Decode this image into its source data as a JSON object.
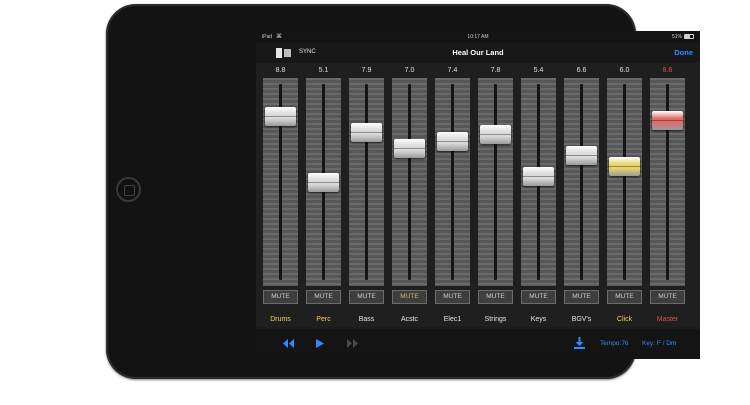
{
  "status_bar": {
    "carrier": "iPad",
    "time": "10:17 AM",
    "battery": "51%"
  },
  "nav": {
    "sync_label": "SYNC",
    "title": "Heal Our Land",
    "done_label": "Done"
  },
  "channels": [
    {
      "name": "Drums",
      "level": "8.8",
      "mute_label": "MUTE",
      "name_color": "#f2d35b",
      "knob_color": "#d9d9d9",
      "level_color": "#e0e0e0",
      "mute_color": "#cfcfcf",
      "fader": 0.88
    },
    {
      "name": "Perc",
      "level": "5.1",
      "mute_label": "MUTE",
      "name_color": "#f2d35b",
      "knob_color": "#d9d9d9",
      "level_color": "#e0e0e0",
      "mute_color": "#cfcfcf",
      "fader": 0.51
    },
    {
      "name": "Bass",
      "level": "7.9",
      "mute_label": "MUTE",
      "name_color": "#e6e6e6",
      "knob_color": "#d9d9d9",
      "level_color": "#e0e0e0",
      "mute_color": "#cfcfcf",
      "fader": 0.79
    },
    {
      "name": "Acstc",
      "level": "7.0",
      "mute_label": "MUTE",
      "name_color": "#e6e6e6",
      "knob_color": "#d9d9d9",
      "level_color": "#e0e0e0",
      "mute_color": "#c9bf5e",
      "fader": 0.7
    },
    {
      "name": "Elec1",
      "level": "7.4",
      "mute_label": "MUTE",
      "name_color": "#e6e6e6",
      "knob_color": "#d9d9d9",
      "level_color": "#e0e0e0",
      "mute_color": "#cfcfcf",
      "fader": 0.74
    },
    {
      "name": "Strings",
      "level": "7.8",
      "mute_label": "MUTE",
      "name_color": "#e6e6e6",
      "knob_color": "#d9d9d9",
      "level_color": "#e0e0e0",
      "mute_color": "#cfcfcf",
      "fader": 0.78
    },
    {
      "name": "Keys",
      "level": "5.4",
      "mute_label": "MUTE",
      "name_color": "#e6e6e6",
      "knob_color": "#d9d9d9",
      "level_color": "#e0e0e0",
      "mute_color": "#cfcfcf",
      "fader": 0.54
    },
    {
      "name": "BGV's",
      "level": "6.6",
      "mute_label": "MUTE",
      "name_color": "#e6e6e6",
      "knob_color": "#d9d9d9",
      "level_color": "#e0e0e0",
      "mute_color": "#cfcfcf",
      "fader": 0.66
    },
    {
      "name": "Click",
      "level": "6.0",
      "mute_label": "MUTE",
      "name_color": "#f2d35b",
      "knob_color": "#e6d36a",
      "level_color": "#e0e0e0",
      "mute_color": "#cfcfcf",
      "fader": 0.6
    },
    {
      "name": "Master",
      "level": "8.6",
      "mute_label": "MUTE",
      "name_color": "#e05252",
      "knob_color": "#e06b6b",
      "level_color": "#e05252",
      "mute_color": "#cfcfcf",
      "fader": 0.86
    }
  ],
  "transport": {
    "rewind_icon": "rewind-icon",
    "play_icon": "play-icon",
    "forward_icon": "fast-forward-icon",
    "download_icon": "download-icon",
    "tempo": "Tempo:76",
    "key": "Key: F / Dm",
    "accent_color": "#2e8bff"
  }
}
